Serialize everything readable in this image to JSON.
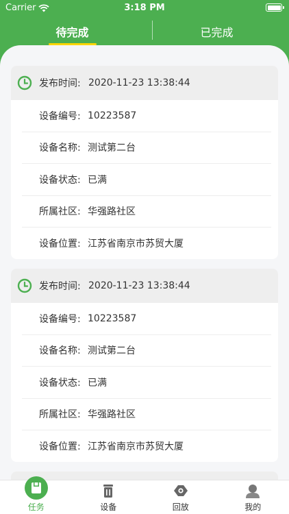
{
  "status": {
    "carrier": "Carrier",
    "time": "3:18 PM"
  },
  "tabs": [
    {
      "label": "待完成",
      "active": true
    },
    {
      "label": "已完成",
      "active": false
    }
  ],
  "labels": {
    "publish_time": "发布时间:",
    "device_no": "设备编号:",
    "device_name": "设备名称:",
    "device_status": "设备状态:",
    "community": "所属社区:",
    "location": "设备位置:"
  },
  "cards": [
    {
      "publish_time": "2020-11-23 13:38:44",
      "device_no": "10223587",
      "device_name": "测试第二台",
      "device_status": "已满",
      "community": "华强路社区",
      "location": "江苏省南京市苏贸大厦"
    },
    {
      "publish_time": "2020-11-23 13:38:44",
      "device_no": "10223587",
      "device_name": "测试第二台",
      "device_status": "已满",
      "community": "华强路社区",
      "location": "江苏省南京市苏贸大厦"
    }
  ],
  "nav": [
    {
      "label": "任务",
      "icon": "task-icon",
      "active": true
    },
    {
      "label": "设备",
      "icon": "trash-bin-icon",
      "active": false
    },
    {
      "label": "回放",
      "icon": "playback-icon",
      "active": false
    },
    {
      "label": "我的",
      "icon": "profile-icon",
      "active": false
    }
  ],
  "colors": {
    "primary": "#4CAF50",
    "tab_indicator": "#FFD600",
    "background": "#F5F6F8"
  }
}
